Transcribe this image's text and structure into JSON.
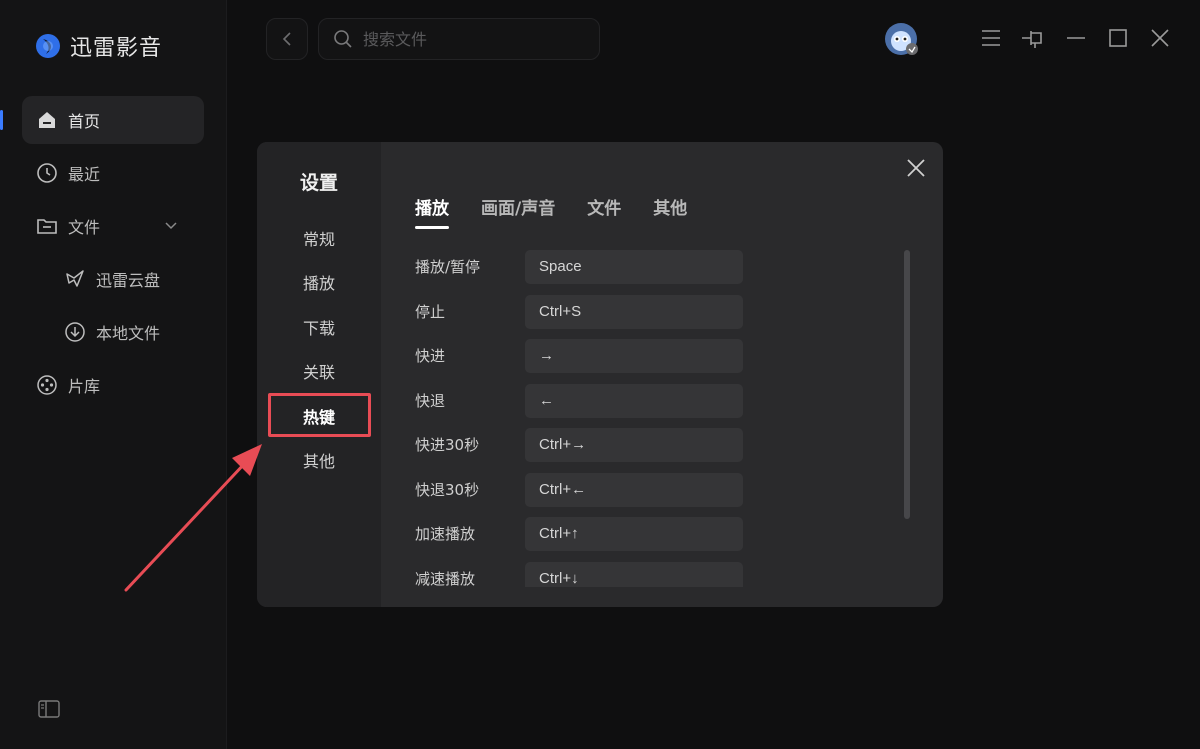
{
  "app": {
    "name": "迅雷影音"
  },
  "sidebar": {
    "items": [
      {
        "label": "首页",
        "icon": "home-icon",
        "active": true
      },
      {
        "label": "最近",
        "icon": "clock-icon"
      },
      {
        "label": "文件",
        "icon": "folder-icon",
        "expanded": true
      },
      {
        "label": "迅雷云盘",
        "icon": "cloud-bird-icon",
        "sub": true
      },
      {
        "label": "本地文件",
        "icon": "download-circle-icon",
        "sub": true
      },
      {
        "label": "片库",
        "icon": "film-reel-icon"
      }
    ]
  },
  "search": {
    "placeholder": "搜索文件"
  },
  "settings": {
    "title": "设置",
    "menu": [
      "常规",
      "播放",
      "下载",
      "关联",
      "热键",
      "其他"
    ],
    "active_menu": "热键",
    "tabs": [
      "播放",
      "画面/声音",
      "文件",
      "其他"
    ],
    "active_tab": "播放",
    "hotkeys": [
      {
        "action": "播放/暂停",
        "key": "Space"
      },
      {
        "action": "停止",
        "key": "Ctrl+S"
      },
      {
        "action": "快进",
        "key": "→"
      },
      {
        "action": "快退",
        "key": "←"
      },
      {
        "action": "快进30秒",
        "key": "Ctrl+→"
      },
      {
        "action": "快退30秒",
        "key": "Ctrl+←"
      },
      {
        "action": "加速播放",
        "key": "Ctrl+↑"
      },
      {
        "action": "减速播放",
        "key": "Ctrl+↓"
      }
    ]
  },
  "colors": {
    "accent": "#3b7cff",
    "annotation": "#e84c55",
    "background": "#0f0f10"
  }
}
